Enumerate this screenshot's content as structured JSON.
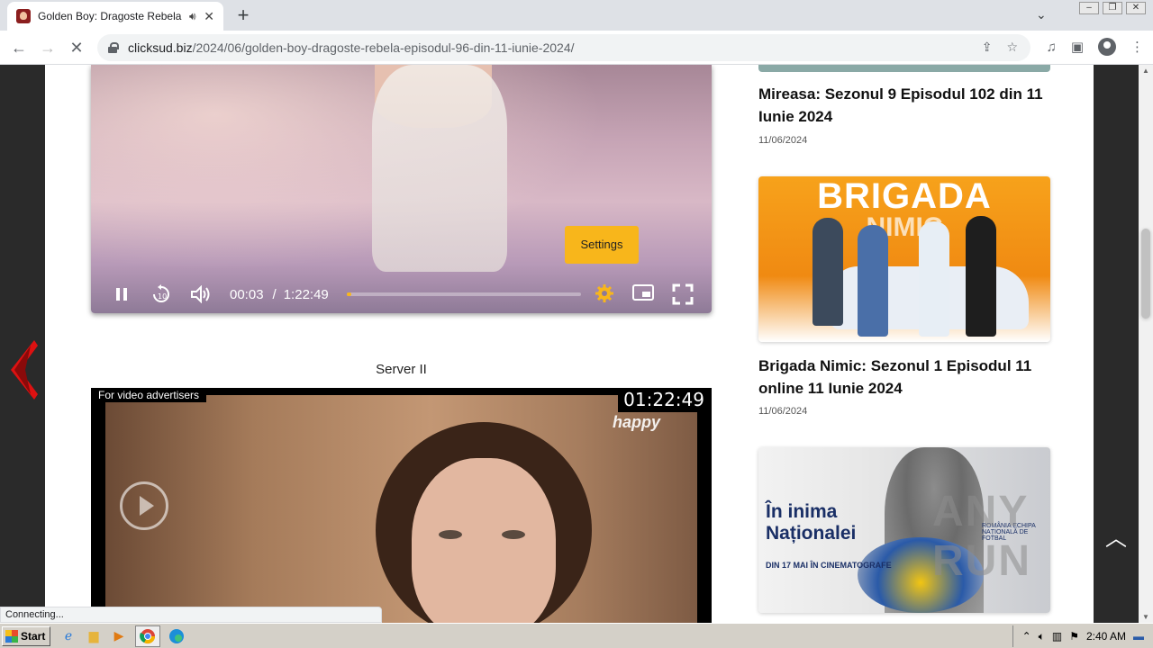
{
  "browser": {
    "tab_title": "Golden Boy: Dragoste Rebela E",
    "tab_audio_icon": "speaker-icon",
    "new_tab_label": "+",
    "url_host": "clicksud.biz",
    "url_path": "/2024/06/golden-boy-dragoste-rebela-episodul-96-din-11-iunie-2024/",
    "status_text": "Connecting..."
  },
  "player1": {
    "settings_tooltip": "Settings",
    "current_time": "00:03",
    "time_separator": "/",
    "duration": "1:22:49",
    "progress_fraction": 0.004
  },
  "server_label": "Server II",
  "player2": {
    "advertiser_label": "For video advertisers",
    "duration_badge": "01:22:49",
    "logo_text": "happy"
  },
  "sidebar": {
    "posts": [
      {
        "title": "Mireasa: Sezonul 9 Episodul 102 din 11 Iunie 2024",
        "date": "11/06/2024"
      },
      {
        "title": "Brigada Nimic: Sezonul 1 Episodul 11 online 11 Iunie 2024",
        "date": "11/06/2024",
        "thumb_text_1": "BRIGADA",
        "thumb_text_2": "NIMIC"
      },
      {
        "thumb_text_1": "În inima",
        "thumb_text_2": "Naționalei",
        "thumb_text_3": "DIN 17 MAI ÎN CINEMATOGRAFE",
        "thumb_crest": "ROMÂNIA ECHIPA NAȚIONALĂ DE FOTBAL"
      }
    ]
  },
  "watermark": "ANY RUN",
  "taskbar": {
    "start_label": "Start",
    "clock": "2:40 AM"
  }
}
